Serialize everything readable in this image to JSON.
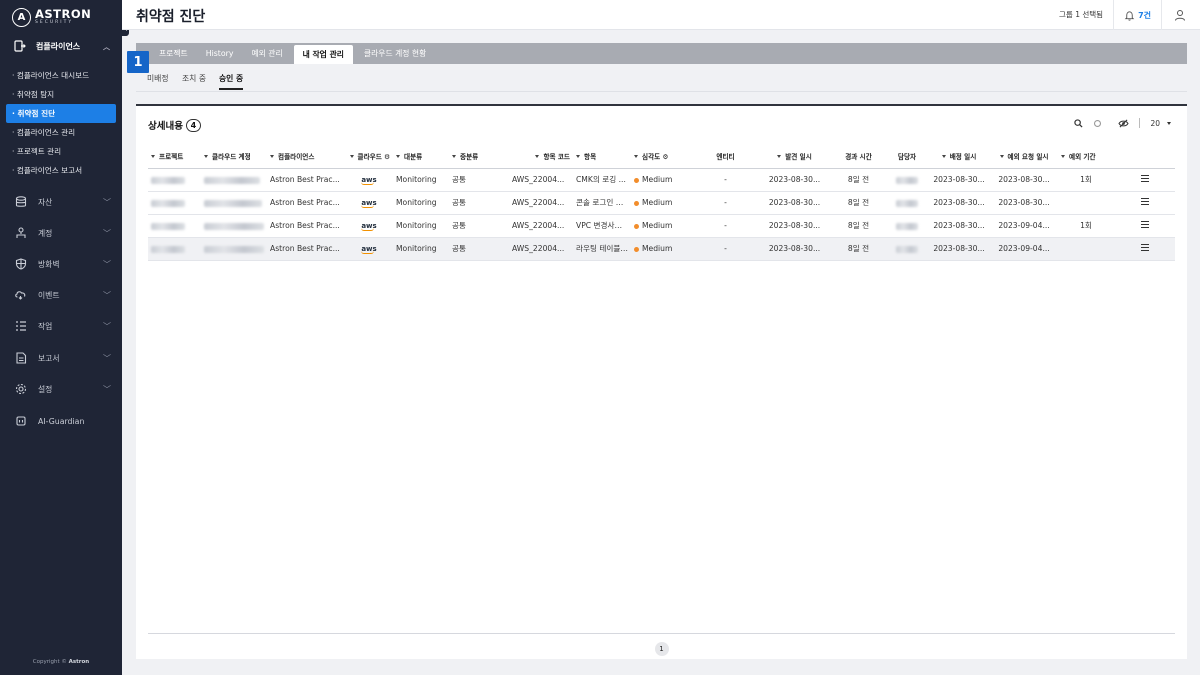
{
  "brand": {
    "logo_letter": "A",
    "name": "ASTRON",
    "sub": "SECURITY"
  },
  "sidebar": {
    "section": "컴플라이언스",
    "sub_items": [
      {
        "label": "· 컴플라이언스 대시보드",
        "active": false
      },
      {
        "label": "· 취약점 탐지",
        "active": false
      },
      {
        "label": "· 취약점 진단",
        "active": true
      },
      {
        "label": "· 컴플라이언스 관리",
        "active": false
      },
      {
        "label": "· 프로젝트 관리",
        "active": false
      },
      {
        "label": "· 컴플라이언스 보고서",
        "active": false
      }
    ],
    "items": [
      {
        "label": "자산",
        "icon": "database-icon"
      },
      {
        "label": "계정",
        "icon": "account-tree-icon"
      },
      {
        "label": "방화벽",
        "icon": "shield-icon"
      },
      {
        "label": "이벤트",
        "icon": "cloud-alert-icon"
      },
      {
        "label": "작업",
        "icon": "task-list-icon"
      },
      {
        "label": "보고서",
        "icon": "report-icon"
      },
      {
        "label": "설정",
        "icon": "gear-icon"
      },
      {
        "label": "AI-Guardian",
        "icon": "ai-chip-icon"
      }
    ],
    "copyright_prefix": "Copyright ©",
    "copyright_brand": "Astron"
  },
  "header": {
    "title": "취약점 진단",
    "group": "그룹 1 선택됨",
    "alerts": "7건"
  },
  "tabs": [
    "프로젝트",
    "History",
    "예외 관리",
    "내 작업 관리",
    "클라우드 계정 현황"
  ],
  "active_tab": 3,
  "step_badge": "1",
  "subtabs": [
    "미배정",
    "조치 중",
    "승인 중"
  ],
  "active_subtab": 2,
  "card": {
    "title": "상세내용",
    "count": "4",
    "page_size": "20"
  },
  "columns": [
    "프로젝트",
    "클라우드 계정",
    "컴플라이언스",
    "클라우드",
    "대분류",
    "중분류",
    "항목 코드",
    "항목",
    "심각도",
    "엔티티",
    "발견 일시",
    "경과 시간",
    "담당자",
    "배정 일시",
    "예외 요청 일시",
    "예외 기간"
  ],
  "rows": [
    {
      "compliance": "Astron Best Prac...",
      "cloud": "aws",
      "major": "Monitoring",
      "minor": "공통",
      "code": "AWS_22004...",
      "item": "CMK의 로깅 ...",
      "severity": "Medium",
      "entity": "-",
      "found": "2023-08-30...",
      "elapsed": "8일 전",
      "assigned": "2023-08-30...",
      "exc_req": "2023-08-30...",
      "exc_period": "1회"
    },
    {
      "compliance": "Astron Best Prac...",
      "cloud": "aws",
      "major": "Monitoring",
      "minor": "공통",
      "code": "AWS_22004...",
      "item": "콘솔 로그인 시...",
      "severity": "Medium",
      "entity": "-",
      "found": "2023-08-30...",
      "elapsed": "8일 전",
      "assigned": "2023-08-30...",
      "exc_req": "2023-08-30...",
      "exc_period": ""
    },
    {
      "compliance": "Astron Best Prac...",
      "cloud": "aws",
      "major": "Monitoring",
      "minor": "공통",
      "code": "AWS_22004...",
      "item": "VPC 변경사항...",
      "severity": "Medium",
      "entity": "-",
      "found": "2023-08-30...",
      "elapsed": "8일 전",
      "assigned": "2023-08-30...",
      "exc_req": "2023-09-04...",
      "exc_period": "1회"
    },
    {
      "compliance": "Astron Best Prac...",
      "cloud": "aws",
      "major": "Monitoring",
      "minor": "공통",
      "code": "AWS_22004...",
      "item": "라우팅 테이블 ...",
      "severity": "Medium",
      "entity": "-",
      "found": "2023-08-30...",
      "elapsed": "8일 전",
      "assigned": "2023-08-30...",
      "exc_req": "2023-09-04...",
      "exc_period": ""
    }
  ],
  "pagination": {
    "current": "1"
  },
  "colors": {
    "accent": "#1d7fe6",
    "sidebar_bg": "#1f2536",
    "severity_medium": "#f28d2b",
    "badge": "#1565c8"
  }
}
